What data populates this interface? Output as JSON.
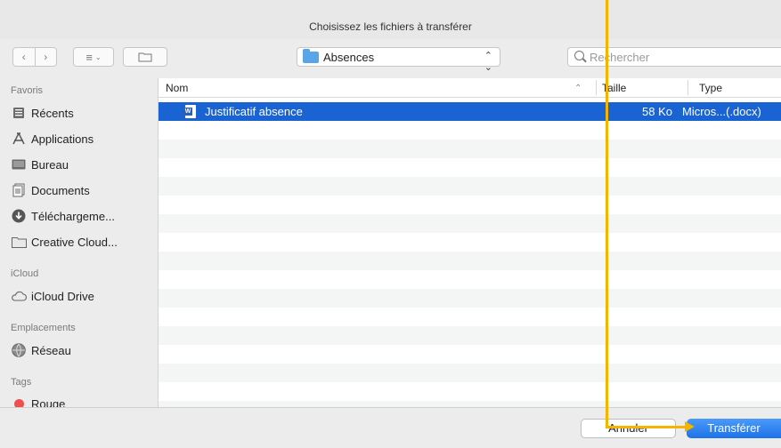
{
  "window": {
    "title": "Choisissez les fichiers à transférer"
  },
  "toolbar": {
    "view_icon": "list-view-icon",
    "location_label": "Absences",
    "search_placeholder": "Rechercher"
  },
  "sidebar": {
    "sections": [
      {
        "title": "Favoris",
        "items": [
          {
            "label": "Récents",
            "icon": "recents-icon"
          },
          {
            "label": "Applications",
            "icon": "applications-icon"
          },
          {
            "label": "Bureau",
            "icon": "desktop-icon"
          },
          {
            "label": "Documents",
            "icon": "documents-icon"
          },
          {
            "label": "Téléchargeme...",
            "icon": "downloads-icon"
          },
          {
            "label": "Creative Cloud...",
            "icon": "folder-icon"
          }
        ]
      },
      {
        "title": "iCloud",
        "items": [
          {
            "label": "iCloud Drive",
            "icon": "cloud-icon"
          }
        ]
      },
      {
        "title": "Emplacements",
        "items": [
          {
            "label": "Réseau",
            "icon": "network-icon"
          }
        ]
      },
      {
        "title": "Tags",
        "items": [
          {
            "label": "Rouge",
            "icon": "red-tag-icon",
            "color": "#ee4f4f"
          }
        ]
      }
    ]
  },
  "file_list": {
    "columns": {
      "name": "Nom",
      "size": "Taille",
      "type": "Type"
    },
    "rows": [
      {
        "name": "Justificatif absence",
        "size": "58 Ko",
        "type": "Micros...(.docx)",
        "selected": true
      }
    ]
  },
  "buttons": {
    "cancel": "Annuler",
    "transfer": "Transférer"
  },
  "colors": {
    "selection": "#1a63d3",
    "primary": "#1e72e8",
    "annotation": "#f5b400"
  }
}
